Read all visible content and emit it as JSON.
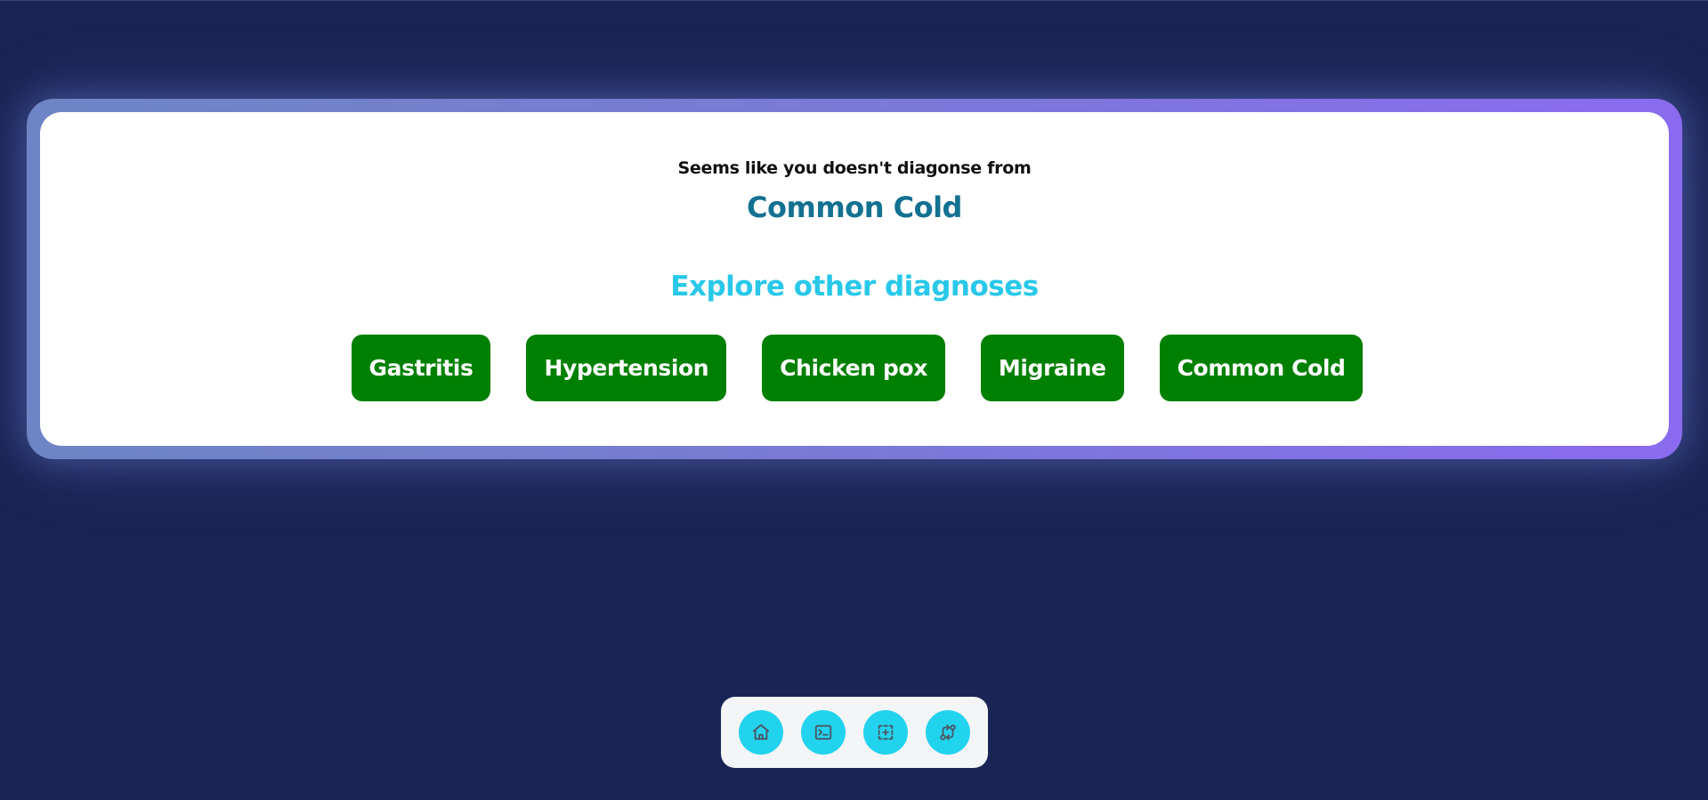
{
  "card": {
    "subtitle": "Seems like you doesn't diagonse from",
    "diagnosis": "Common Cold",
    "explore_heading": "Explore other diagnoses",
    "diagnoses": [
      {
        "label": "Gastritis"
      },
      {
        "label": "Hypertension"
      },
      {
        "label": "Chicken pox"
      },
      {
        "label": "Migraine"
      },
      {
        "label": "Common Cold"
      }
    ]
  },
  "dock": {
    "items": [
      {
        "icon": "home-icon"
      },
      {
        "icon": "terminal-icon"
      },
      {
        "icon": "focus-add-icon"
      },
      {
        "icon": "git-compare-icon"
      }
    ]
  },
  "colors": {
    "background": "#1a2555",
    "diagnosis_text": "#137191",
    "explore_text": "#29c8e9",
    "button_green": "#008000",
    "dock_button": "#22d3ee"
  }
}
